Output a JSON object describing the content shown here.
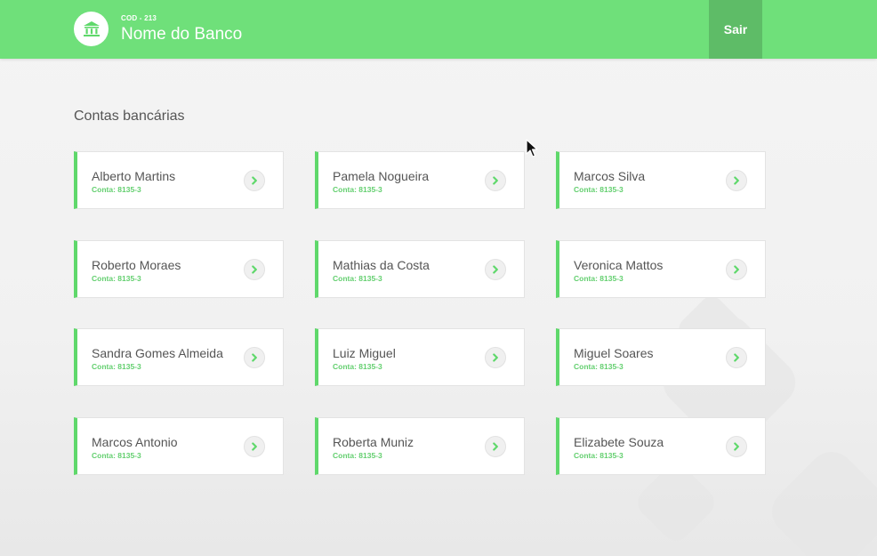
{
  "header": {
    "bank_code": "COD - 213",
    "bank_name": "Nome do Banco",
    "logo_icon": "bank-icon",
    "logout_label": "Sair"
  },
  "colors": {
    "header_green": "#6fe07a",
    "logout_green": "#5ebc67",
    "accent_green": "#5fd86b",
    "account_text_green": "#63cf6f"
  },
  "section": {
    "title": "Contas bancárias"
  },
  "accounts": [
    {
      "name": "Alberto Martins",
      "account": "Conta: 8135-3"
    },
    {
      "name": "Pamela Nogueira",
      "account": "Conta: 8135-3"
    },
    {
      "name": "Marcos Silva",
      "account": "Conta: 8135-3"
    },
    {
      "name": "Roberto Moraes",
      "account": "Conta: 8135-3"
    },
    {
      "name": "Mathias da Costa",
      "account": "Conta: 8135-3"
    },
    {
      "name": "Veronica Mattos",
      "account": "Conta: 8135-3"
    },
    {
      "name": "Sandra Gomes Almeida",
      "account": "Conta: 8135-3"
    },
    {
      "name": "Luiz Miguel",
      "account": "Conta: 8135-3"
    },
    {
      "name": "Miguel Soares",
      "account": "Conta: 8135-3"
    },
    {
      "name": "Marcos Antonio",
      "account": "Conta: 8135-3"
    },
    {
      "name": "Roberta Muniz",
      "account": "Conta: 8135-3"
    },
    {
      "name": "Elizabete Souza",
      "account": "Conta: 8135-3"
    }
  ]
}
